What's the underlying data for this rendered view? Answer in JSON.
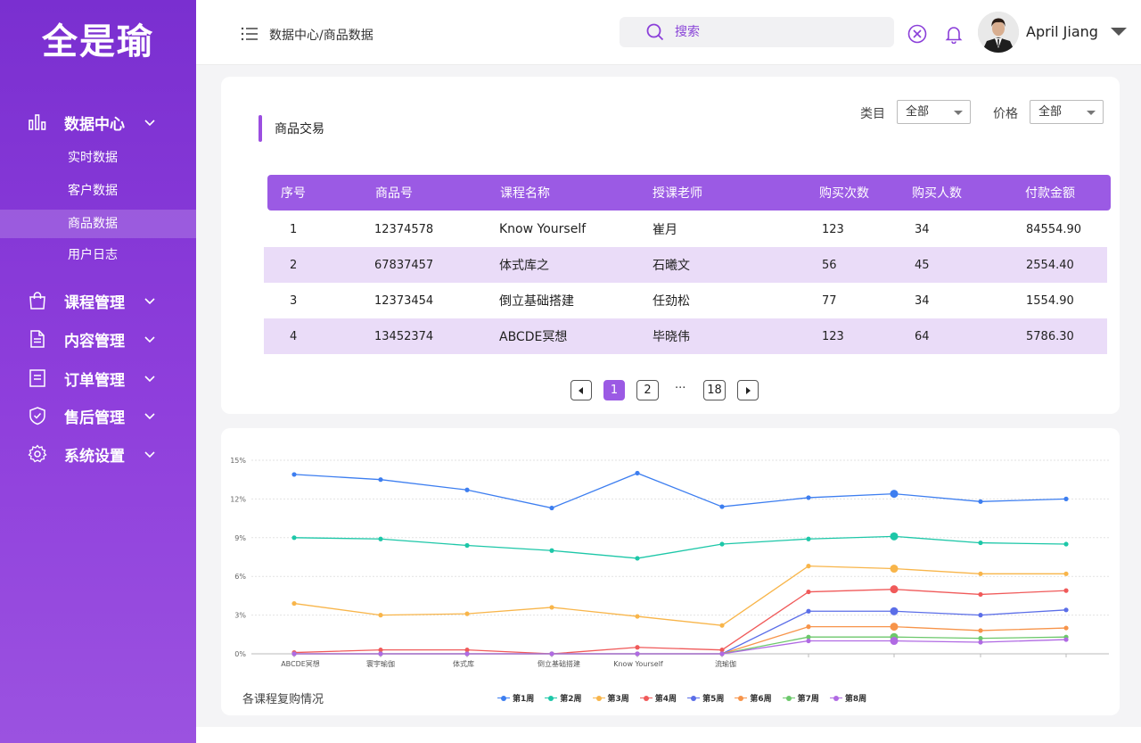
{
  "app": {
    "logo": "全是瑜"
  },
  "sidebar": {
    "groups": [
      {
        "label": "数据中心",
        "icon": "bar-chart-icon"
      },
      {
        "label": "课程管理",
        "icon": "shopping-bag-icon"
      },
      {
        "label": "内容管理",
        "icon": "document-icon"
      },
      {
        "label": "订单管理",
        "icon": "order-list-icon"
      },
      {
        "label": "售后管理",
        "icon": "shield-check-icon"
      },
      {
        "label": "系统设置",
        "icon": "gear-icon"
      }
    ],
    "sub_items": [
      {
        "label": "实时数据",
        "active": false
      },
      {
        "label": "客户数据",
        "active": false
      },
      {
        "label": "商品数据",
        "active": true
      },
      {
        "label": "用户日志",
        "active": false
      }
    ]
  },
  "header": {
    "breadcrumb": "数据中心/商品数据",
    "search_placeholder": "搜索",
    "user_name": "April Jiang",
    "colors": {
      "accent": "#8b3fd9"
    }
  },
  "trade": {
    "title": "商品交易",
    "filters": [
      {
        "label": "类目",
        "value": "全部"
      },
      {
        "label": "价格",
        "value": "全部"
      }
    ],
    "columns": [
      "序号",
      "商品号",
      "课程名称",
      "授课老师",
      "购买次数",
      "购买人数",
      "付款金额"
    ],
    "rows": [
      [
        "1",
        "12374578",
        "Know Yourself",
        "崔月",
        "123",
        "34",
        "84554.90"
      ],
      [
        "2",
        "67837457",
        "体式库之",
        "石曦文",
        "56",
        "45",
        "2554.40"
      ],
      [
        "3",
        "12373454",
        "倒立基础搭建",
        "任劲松",
        "77",
        "34",
        "1554.90"
      ],
      [
        "4",
        "13452374",
        "ABCDE冥想",
        "毕晓伟",
        "123",
        "64",
        "5786.30"
      ]
    ],
    "pagination": {
      "pages": [
        "1",
        "2",
        "18"
      ],
      "ellipsis": "···",
      "current": "1"
    }
  },
  "chart_data": {
    "type": "line",
    "title": "各课程复购情况",
    "categories": [
      "ABCDE冥想",
      "寰宇瑜伽",
      "体式库",
      "",
      "倒立基础搭建",
      "",
      "Know Yourself",
      "",
      "流瑜伽",
      "",
      "",
      "",
      "",
      "",
      "",
      "",
      "",
      "",
      "",
      ""
    ],
    "x_labels": [
      "ABCDE冥想",
      "寰宇瑜伽",
      "体式库",
      "倒立基础搭建",
      "Know Yourself",
      "流瑜伽"
    ],
    "y_ticks": [
      "0%",
      "3%",
      "6%",
      "9%",
      "12%",
      "15%"
    ],
    "ylim": [
      0,
      15
    ],
    "grid": true,
    "legend_position": "bottom",
    "series": [
      {
        "name": "第1周",
        "color": "#3d7ef0",
        "values": [
          13.9,
          13.5,
          12.7,
          11.3,
          14.0,
          11.4,
          12.1,
          12.4,
          11.8,
          12.0
        ]
      },
      {
        "name": "第2周",
        "color": "#1dc7a8",
        "values": [
          9.0,
          8.9,
          8.4,
          8.0,
          7.4,
          8.5,
          8.9,
          9.1,
          8.6,
          8.5
        ]
      },
      {
        "name": "第3周",
        "color": "#f8b54a",
        "values": [
          3.9,
          3.0,
          3.1,
          3.6,
          2.9,
          2.2,
          6.8,
          6.6,
          6.2,
          6.2
        ]
      },
      {
        "name": "第4周",
        "color": "#f05a5a",
        "values": [
          0.1,
          0.3,
          0.3,
          0.0,
          0.5,
          0.3,
          4.8,
          5.0,
          4.6,
          4.9
        ]
      },
      {
        "name": "第5周",
        "color": "#5b6ee8",
        "values": [
          0.0,
          0.0,
          0.0,
          0.0,
          0.0,
          0.0,
          3.3,
          3.3,
          3.0,
          3.4
        ]
      },
      {
        "name": "第6周",
        "color": "#f7944a",
        "values": [
          0.0,
          0.0,
          0.0,
          0.0,
          0.0,
          0.0,
          2.1,
          2.1,
          1.8,
          2.0
        ]
      },
      {
        "name": "第7周",
        "color": "#6cc86b",
        "values": [
          0.0,
          0.0,
          0.0,
          0.0,
          0.0,
          0.0,
          1.3,
          1.3,
          1.2,
          1.3
        ]
      },
      {
        "name": "第8周",
        "color": "#b06ae3",
        "values": [
          0.0,
          0.0,
          0.0,
          0.0,
          0.0,
          0.0,
          1.0,
          1.0,
          0.9,
          1.1
        ]
      }
    ],
    "highlight_index": 7
  }
}
